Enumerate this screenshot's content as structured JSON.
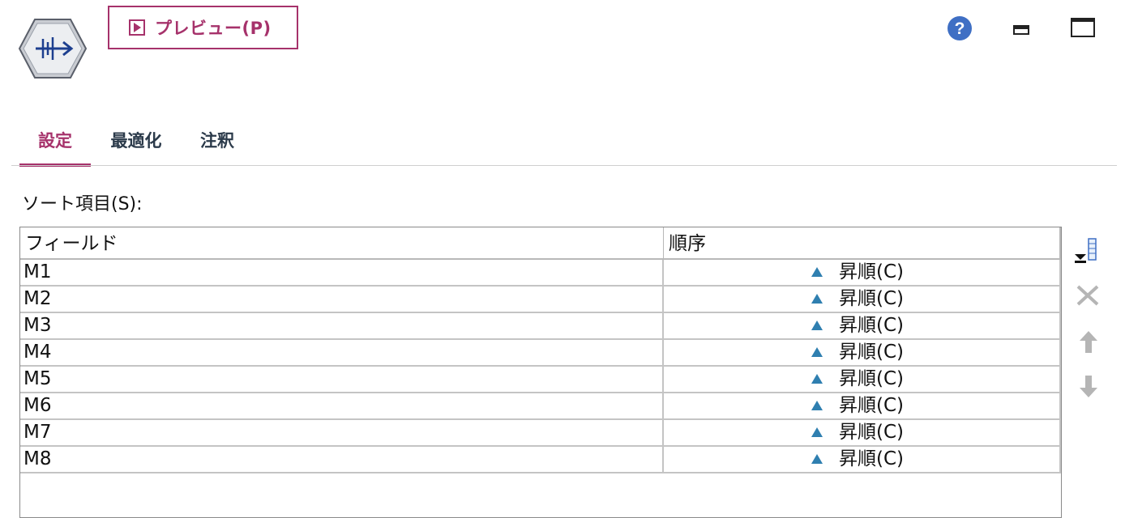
{
  "toolbar": {
    "node_icon": "sort-node-icon",
    "preview_label": "プレビュー(P)",
    "help_icon": "help-icon",
    "minimize_icon": "minimize-icon",
    "maximize_icon": "maximize-icon"
  },
  "tabs": [
    {
      "label": "設定",
      "active": true
    },
    {
      "label": "最適化",
      "active": false
    },
    {
      "label": "注釈",
      "active": false
    }
  ],
  "sort_section": {
    "label": "ソート項目(S):",
    "columns": [
      "フィールド",
      "順序"
    ],
    "rows": [
      {
        "field": "M1",
        "order": "昇順(C)"
      },
      {
        "field": "M2",
        "order": "昇順(C)"
      },
      {
        "field": "M3",
        "order": "昇順(C)"
      },
      {
        "field": "M4",
        "order": "昇順(C)"
      },
      {
        "field": "M5",
        "order": "昇順(C)"
      },
      {
        "field": "M6",
        "order": "昇順(C)"
      },
      {
        "field": "M7",
        "order": "昇順(C)"
      },
      {
        "field": "M8",
        "order": "昇順(C)"
      }
    ]
  },
  "side_buttons": [
    "add-field-icon",
    "delete-icon",
    "move-up-icon",
    "move-down-icon"
  ],
  "colors": {
    "accent": "#a6326b",
    "help_blue": "#3f6fc4",
    "asc_icon": "#2f7fb0"
  }
}
